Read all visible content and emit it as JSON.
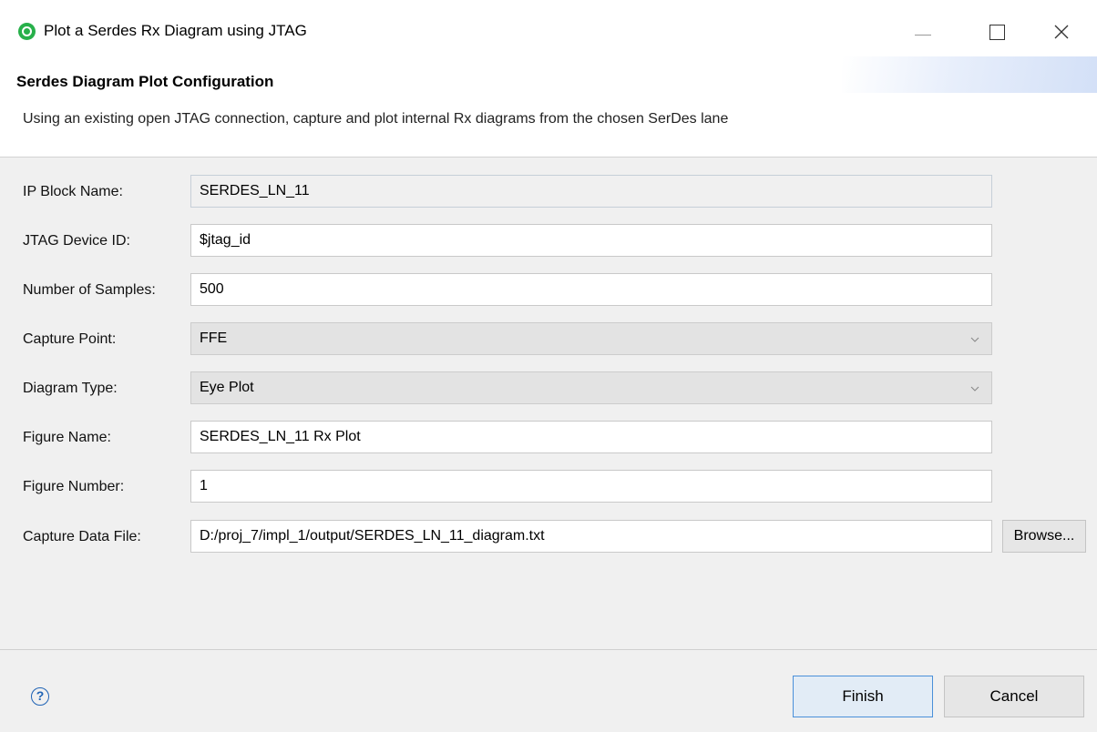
{
  "window": {
    "title": "Plot a Serdes Rx Diagram using JTAG",
    "icon": "app-logo-icon"
  },
  "banner": {
    "title": "Serdes Diagram Plot Configuration",
    "description": "Using an existing open JTAG connection, capture and plot internal Rx diagrams from the chosen SerDes lane"
  },
  "form": {
    "ip_block_name": {
      "label": "IP Block Name:",
      "value": "SERDES_LN_11"
    },
    "jtag_device_id": {
      "label": "JTAG Device ID:",
      "value": "$jtag_id"
    },
    "num_samples": {
      "label": "Number of Samples:",
      "value": "500"
    },
    "capture_point": {
      "label": "Capture Point:",
      "value": "FFE"
    },
    "diagram_type": {
      "label": "Diagram Type:",
      "value": "Eye Plot"
    },
    "figure_name": {
      "label": "Figure Name:",
      "value": "SERDES_LN_11 Rx Plot"
    },
    "figure_number": {
      "label": "Figure Number:",
      "value": "1"
    },
    "capture_file": {
      "label": "Capture Data File:",
      "value": "D:/proj_7/impl_1/output/SERDES_LN_11_diagram.txt",
      "browse_label": "Browse..."
    }
  },
  "footer": {
    "help_symbol": "?",
    "finish_label": "Finish",
    "cancel_label": "Cancel"
  },
  "colors": {
    "accent_border": "#4a90d9",
    "help_blue": "#1f63b5",
    "app_icon_green": "#27b04a"
  }
}
